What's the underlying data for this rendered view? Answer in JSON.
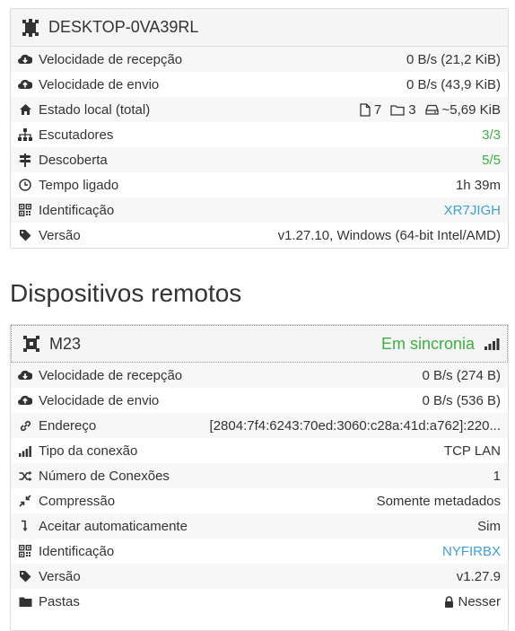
{
  "local": {
    "title": "DESKTOP-0VA39RL",
    "rows": [
      {
        "label": "Velocidade de recepção",
        "value": "0 B/s (21,2 KiB)"
      },
      {
        "label": "Velocidade de envio",
        "value": "0 B/s (43,9 KiB)"
      },
      {
        "label": "Estado local (total)",
        "files": "7",
        "folders": "3",
        "size": "~5,69 KiB"
      },
      {
        "label": "Escutadores",
        "value": "3/3"
      },
      {
        "label": "Descoberta",
        "value": "5/5"
      },
      {
        "label": "Tempo ligado",
        "value": "1h 39m"
      },
      {
        "label": "Identificação",
        "value": "XR7JIGH"
      },
      {
        "label": "Versão",
        "value": "v1.27.10, Windows (64-bit Intel/AMD)"
      }
    ]
  },
  "section_title": "Dispositivos remotos",
  "remote": {
    "name": "M23",
    "status": "Em sincronia",
    "rows": [
      {
        "label": "Velocidade de recepção",
        "value": "0 B/s (274 B)"
      },
      {
        "label": "Velocidade de envio",
        "value": "0 B/s (536 B)"
      },
      {
        "label": "Endereço",
        "value": "[2804:7f4:6243:70ed:3060:c28a:41d:a762]:220..."
      },
      {
        "label": "Tipo da conexão",
        "value": "TCP LAN"
      },
      {
        "label": "Número de Conexões",
        "value": "1"
      },
      {
        "label": "Compressão",
        "value": "Somente metadados"
      },
      {
        "label": "Aceitar automaticamente",
        "value": "Sim"
      },
      {
        "label": "Identificação",
        "value": "NYFIRBX"
      },
      {
        "label": "Versão",
        "value": "v1.27.9"
      },
      {
        "label": "Pastas",
        "value": "Nesser"
      }
    ]
  },
  "colors": {
    "green": "#3cb043",
    "link": "#3aa0d6",
    "header_bg": "#f5f5f5"
  }
}
